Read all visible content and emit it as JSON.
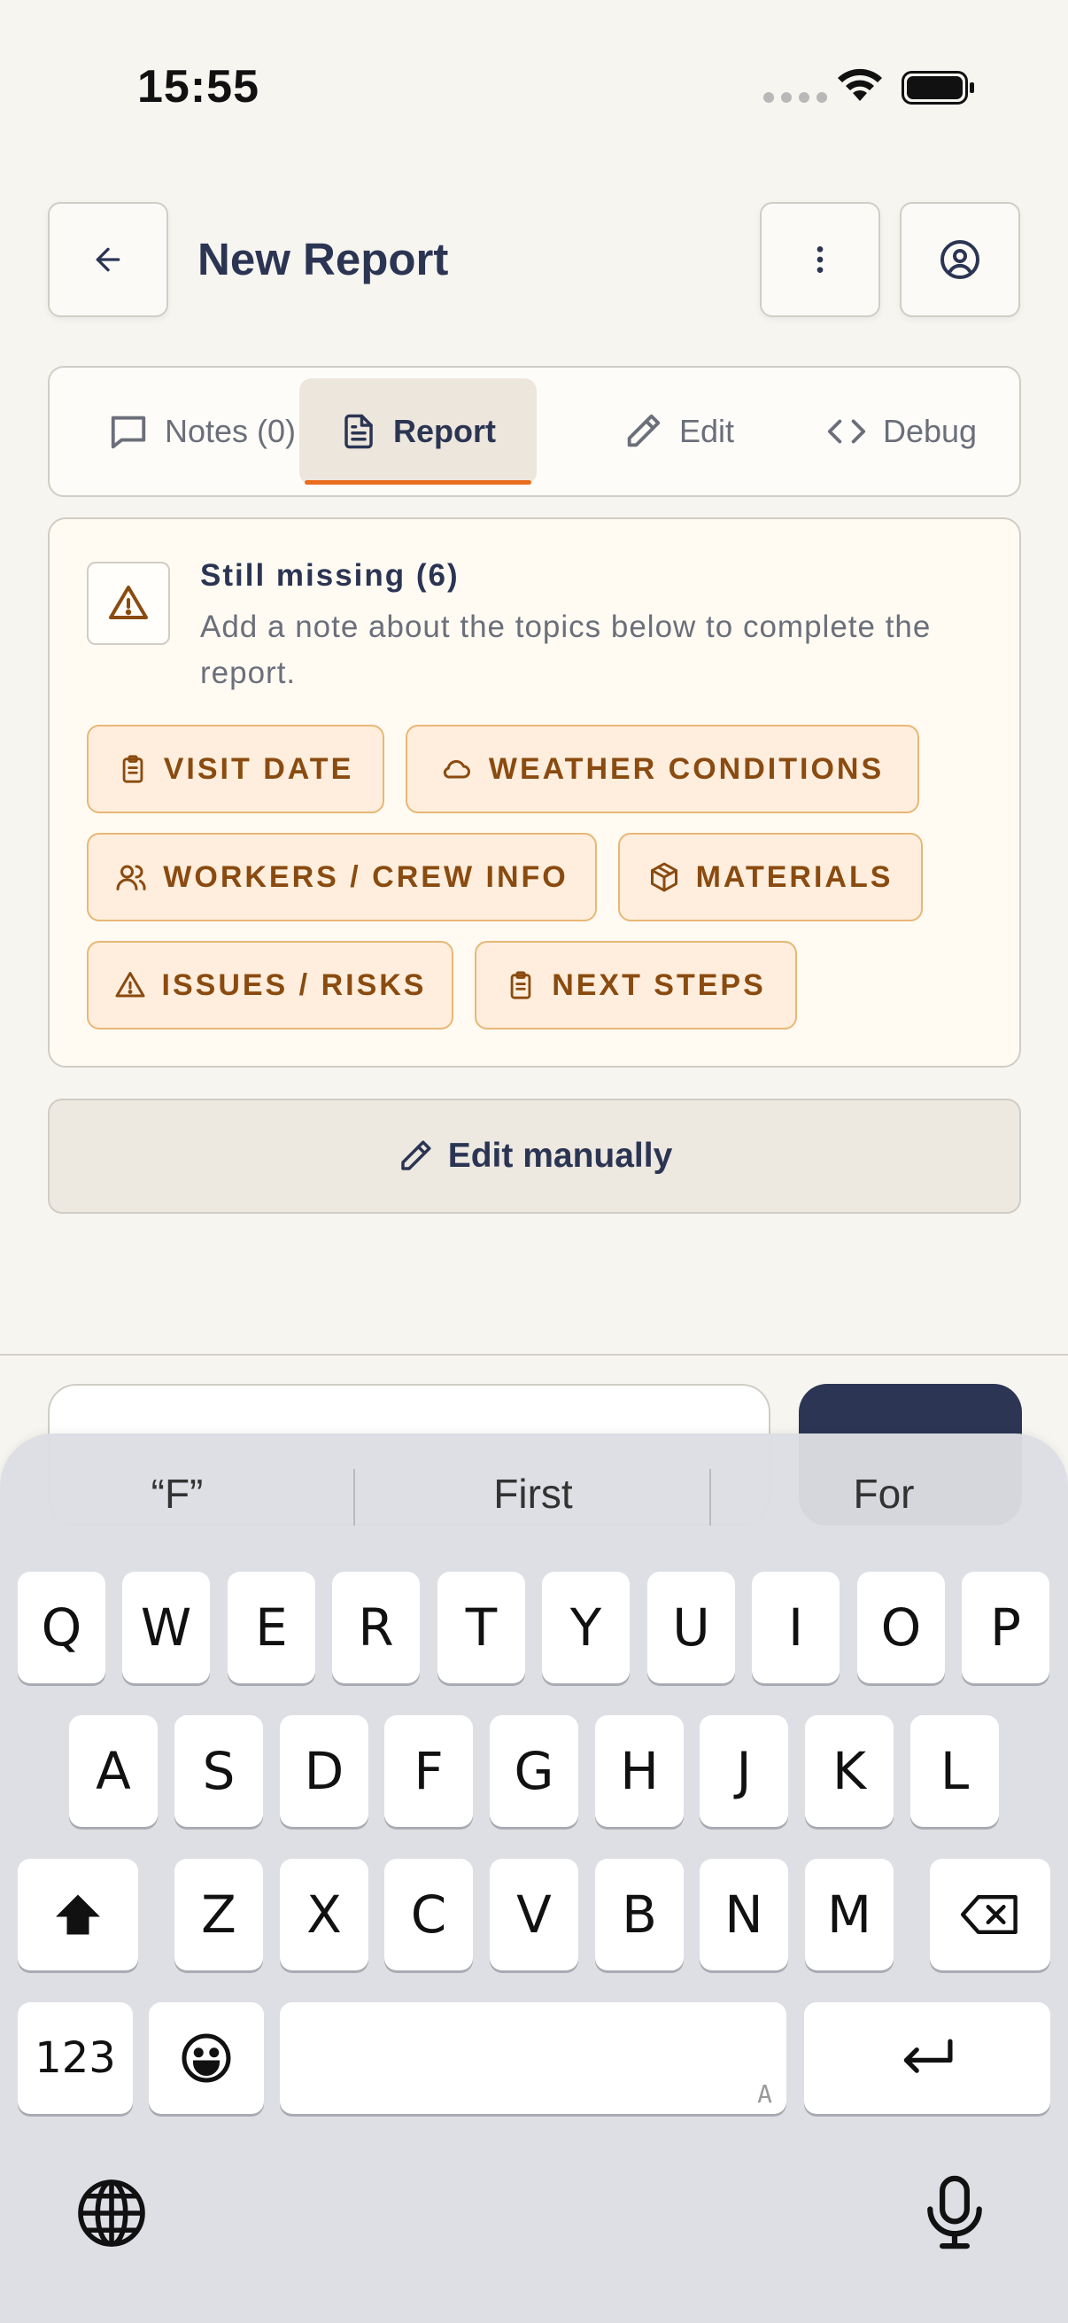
{
  "status": {
    "time": "15:55"
  },
  "header": {
    "title": "New Report"
  },
  "tabs": [
    {
      "label": "Notes (0)"
    },
    {
      "label": "Report"
    },
    {
      "label": "Edit"
    },
    {
      "label": "Debug"
    }
  ],
  "missing": {
    "title": "Still missing (6)",
    "description": "Add a note about the topics below to complete the report.",
    "chips": [
      {
        "label": "VISIT DATE",
        "icon": "clipboard-icon"
      },
      {
        "label": "WEATHER CONDITIONS",
        "icon": "cloud-icon"
      },
      {
        "label": "WORKERS / CREW INFO",
        "icon": "users-icon"
      },
      {
        "label": "MATERIALS",
        "icon": "package-icon"
      },
      {
        "label": "ISSUES / RISKS",
        "icon": "warning-icon"
      },
      {
        "label": "NEXT STEPS",
        "icon": "clipboard-icon"
      }
    ]
  },
  "edit_manually": {
    "label": "Edit manually"
  },
  "keyboard": {
    "suggestions": [
      "“F”",
      "First",
      "For"
    ],
    "row1": [
      "Q",
      "W",
      "E",
      "R",
      "T",
      "Y",
      "U",
      "I",
      "O",
      "P"
    ],
    "row2": [
      "A",
      "S",
      "D",
      "F",
      "G",
      "H",
      "J",
      "K",
      "L"
    ],
    "row3": [
      "Z",
      "X",
      "C",
      "V",
      "B",
      "N",
      "M"
    ],
    "numbers_key": "123",
    "space_mark": "A"
  },
  "colors": {
    "accent": "#ea6d1e",
    "navy": "#2c3654",
    "chip_bg": "#ffeedd",
    "chip_border": "#e8b776",
    "chip_text": "#8a4b10"
  }
}
